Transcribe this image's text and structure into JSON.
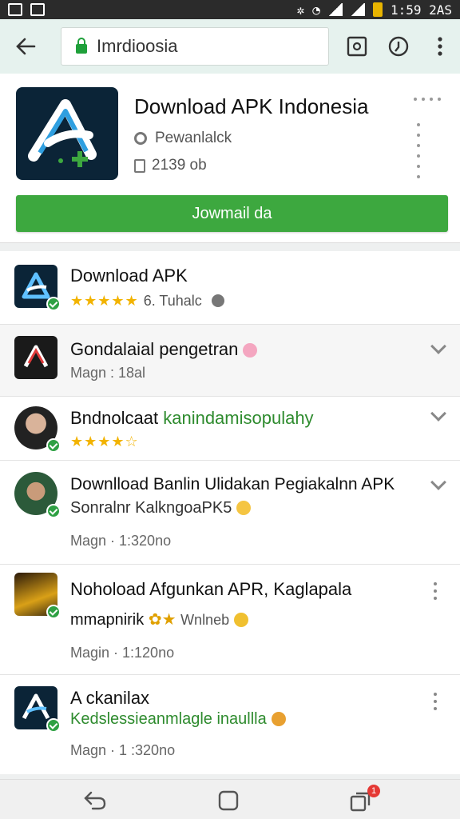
{
  "status_bar": {
    "time": "1:59 2AS"
  },
  "browser": {
    "url_text": "Imrdioosia"
  },
  "app_card": {
    "title": "Download APK Indonesia",
    "developer": "Pewanlalck",
    "size": "2139 ob",
    "download_button_label": "Jowmail da"
  },
  "list": [
    {
      "title": "Download APK",
      "rating_text": "6. Tuhalc",
      "stars": 5
    },
    {
      "title": "Gondalaial pengetran",
      "meta": "Magn : 18al"
    },
    {
      "title_prefix": "Bndnolcaat",
      "title_green": "kanindamisopulahy",
      "stars": 4
    },
    {
      "title": "Downlload Banlin Ulidakan Pegiakalnn APK",
      "line2": "Sonralnr KalkngoaPK5",
      "meta": "Magn · 1:320no"
    },
    {
      "title": "Nohoload Afgunkan APR, Kaglapala",
      "line2_prefix": "mmapnirik",
      "line2_rest": "Wnlneb",
      "meta": "Magin · 1:120no"
    },
    {
      "title": "A ckanilax",
      "line2": "Kedslessieanmlagle inaullla",
      "meta": "Magn · 1 :320no"
    }
  ],
  "nav": {
    "recents_badge": "1"
  },
  "colors": {
    "accent_green": "#3da83f",
    "toolbar_bg": "#e6f2ee",
    "status_bar": "#2b2b2b",
    "badge_red": "#e53935"
  }
}
